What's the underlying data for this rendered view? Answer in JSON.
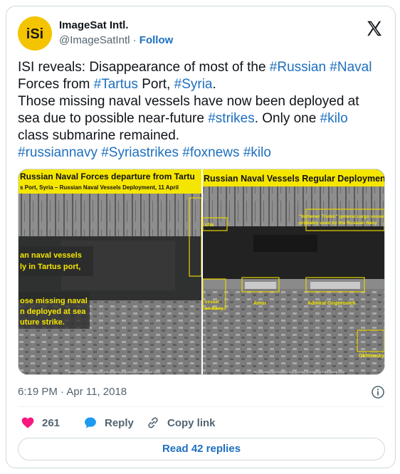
{
  "author": {
    "display_name": "ImageSat Intl.",
    "handle": "@ImageSatIntl",
    "separator": "·",
    "follow_label": "Follow",
    "avatar_text": "iSi"
  },
  "tweet": {
    "segments": [
      {
        "text": "ISI reveals: Disappearance of most of the ",
        "tag": false
      },
      {
        "text": "#Russian",
        "tag": true
      },
      {
        "text": " ",
        "tag": false
      },
      {
        "text": "#Naval",
        "tag": true
      },
      {
        "text": "\nForces from ",
        "tag": false
      },
      {
        "text": "#Tartus",
        "tag": true
      },
      {
        "text": " Port, ",
        "tag": false
      },
      {
        "text": "#Syria",
        "tag": true
      },
      {
        "text": ".\nThose missing naval vessels have now been deployed at\nsea due to possible near-future ",
        "tag": false
      },
      {
        "text": "#strikes",
        "tag": true
      },
      {
        "text": ". Only one ",
        "tag": false
      },
      {
        "text": "#kilo",
        "tag": true
      },
      {
        "text": "\nclass submarine remained.\n",
        "tag": false
      },
      {
        "text": "#russiannavy",
        "tag": true
      },
      {
        "text": " ",
        "tag": false
      },
      {
        "text": "#Syriastrikes",
        "tag": true
      },
      {
        "text": " ",
        "tag": false
      },
      {
        "text": "#foxnews",
        "tag": true
      },
      {
        "text": " ",
        "tag": false
      },
      {
        "text": "#kilo",
        "tag": true
      }
    ]
  },
  "media": {
    "left_title": "Russian Naval Forces departure from Tartu",
    "left_subtitle": "s Port, Syria – Russian Naval Vessels Deployment, 11 April",
    "left_note_1": [
      "an  naval  vessels",
      "ly in Tartus port,"
    ],
    "left_note_2": [
      "ose missing naval",
      "n deployed at sea",
      "uture strike."
    ],
    "right_title": "Russian Naval Vessels Regular Deployment",
    "right_labels": {
      "cargo": [
        "\"Inzhener Trubin\" general cargo vessel",
        "probably used by the Russian Navy"
      ],
      "cha": "cha",
      "vessel": [
        "vessel",
        "an Navy"
      ],
      "amur": "Amur",
      "grigorovich": "Admiral Grigorovich",
      "okhtensky": "Okhtensky"
    },
    "left_footer": "All information presented is sole property of ImageSat International 2018",
    "right_footer": "All information presented is sole property of ImageSat International 2018"
  },
  "meta": {
    "timestamp": "6:19 PM · Apr 11, 2018"
  },
  "actions": {
    "like_count": "261",
    "reply_label": "Reply",
    "copy_label": "Copy link"
  },
  "read_replies_label": "Read 42 replies",
  "colors": {
    "link": "#1d6fbf",
    "like": "#f91880",
    "reply_icon": "#1d9bf0",
    "banner": "#f5e600"
  }
}
